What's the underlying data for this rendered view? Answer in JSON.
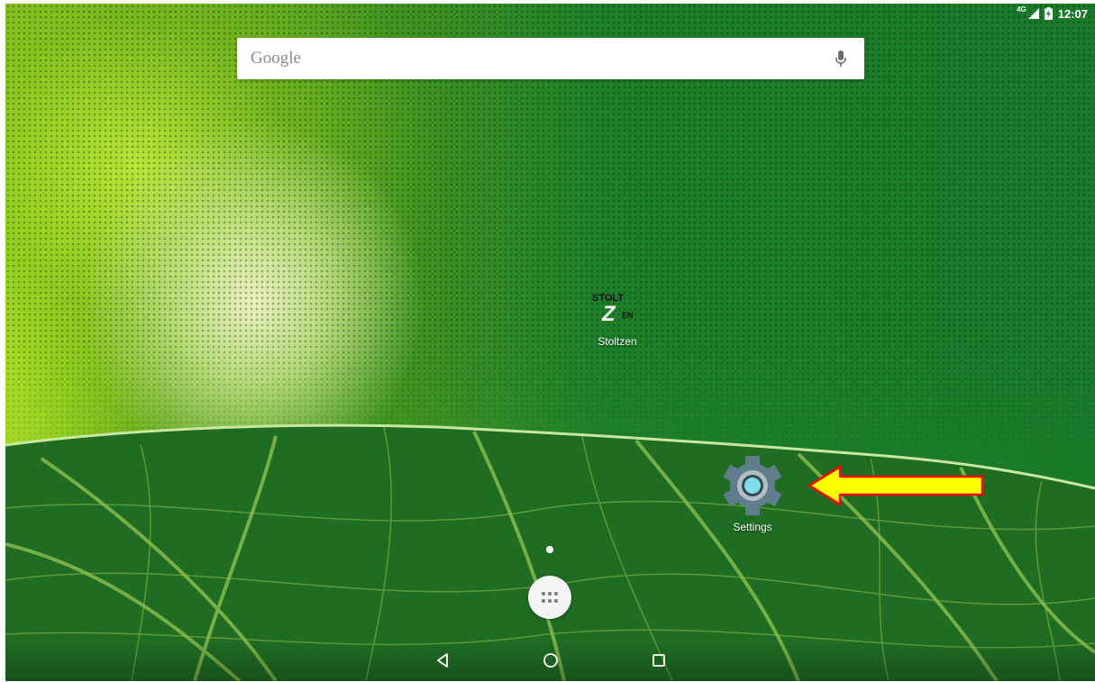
{
  "status_bar": {
    "network": "4G",
    "time": "12:07"
  },
  "search": {
    "placeholder": "Google"
  },
  "apps": {
    "stoltzen": {
      "label": "Stoltzen",
      "logo_text_top": "STOLT",
      "logo_letter": "Z",
      "logo_text_side": "EN"
    },
    "settings": {
      "label": "Settings"
    }
  },
  "icons": {
    "mic": "mic-icon",
    "gear": "settings-gear-icon",
    "app_drawer": "app-drawer-icon",
    "back": "back-icon",
    "home": "home-icon",
    "recents": "recents-icon",
    "annotation": "arrow-annotation-icon"
  },
  "colors": {
    "annotation_arrow_fill": "#ffff00",
    "annotation_arrow_stroke": "#ff0000",
    "gear_outer": "#607d8b",
    "gear_inner": "#80deea"
  }
}
